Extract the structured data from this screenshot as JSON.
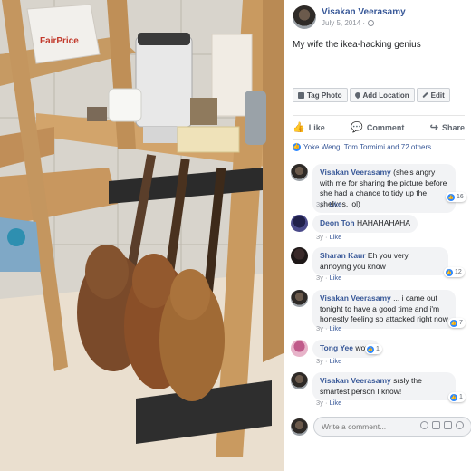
{
  "post": {
    "author": "Visakan Veerasamy",
    "date": "July 5, 2014 ·",
    "text": "My wife the ikea-hacking genius"
  },
  "photo_actions": {
    "tag": "Tag Photo",
    "location": "Add Location",
    "edit": "Edit"
  },
  "actions": {
    "like": "Like",
    "comment": "Comment",
    "share": "Share"
  },
  "likes_summary": "Yoke Weng, Tom Tormimi and 72 others",
  "photo": {
    "bag_text": "FairPrice"
  },
  "comments": [
    {
      "author": "Visakan Veerasamy",
      "text": "(she's angry with me for sharing the picture before she had a chance to tidy up the shelves, lol)",
      "time": "3y",
      "like": "Like",
      "reactions": "16"
    },
    {
      "author": "Deon Toh",
      "text": "HAHAHAHAHA",
      "time": "3y",
      "like": "Like",
      "reactions": ""
    },
    {
      "author": "Sharan Kaur",
      "text": "Eh you very annoying you know",
      "time": "3y",
      "like": "Like",
      "reactions": "12"
    },
    {
      "author": "Visakan Veerasamy",
      "text": "... i came out tonight to have a good time and i'm honestly feeling so attacked right now",
      "time": "3y",
      "like": "Like",
      "reactions": "7"
    },
    {
      "author": "Tong Yee",
      "text": "wow.",
      "time": "3y",
      "like": "Like",
      "reactions": "1"
    },
    {
      "author": "Visakan Veerasamy",
      "text": "srsly the smartest person I know!",
      "time": "3y",
      "like": "Like",
      "reactions": "1"
    }
  ],
  "write_comment": {
    "placeholder": "Write a comment..."
  },
  "colors": {
    "link": "#385898",
    "like_blue": "#2d88ff",
    "bubble": "#f2f3f5"
  }
}
